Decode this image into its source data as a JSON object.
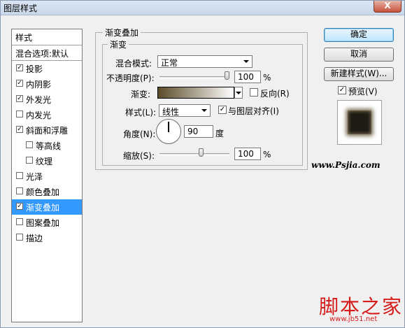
{
  "window": {
    "title": "图层样式",
    "close": "X"
  },
  "left_panel": {
    "header": "样式",
    "blend_options": "混合选项:默认",
    "items": [
      {
        "label": "投影",
        "checked": true
      },
      {
        "label": "内阴影",
        "checked": true
      },
      {
        "label": "外发光",
        "checked": true
      },
      {
        "label": "内发光",
        "checked": false
      },
      {
        "label": "斜面和浮雕",
        "checked": true
      },
      {
        "label": "等高线",
        "checked": false
      },
      {
        "label": "纹理",
        "checked": false
      },
      {
        "label": "光泽",
        "checked": false
      },
      {
        "label": "颜色叠加",
        "checked": false
      },
      {
        "label": "渐变叠加",
        "checked": true,
        "selected": true
      },
      {
        "label": "图案叠加",
        "checked": false
      },
      {
        "label": "描边",
        "checked": false
      }
    ]
  },
  "gradient_overlay": {
    "outer_title": "渐变叠加",
    "inner_title": "渐变",
    "blend_mode_label": "混合模式:",
    "blend_mode_value": "正常",
    "opacity_label": "不透明度(P):",
    "opacity_value": "100",
    "opacity_unit": "%",
    "opacity_fraction": 1.0,
    "gradient_label": "渐变:",
    "reverse_label": "反向(R)",
    "reverse_checked": false,
    "style_label": "样式(L):",
    "style_value": "线性",
    "align_label": "与图层对齐(I)",
    "align_checked": true,
    "angle_label": "角度(N):",
    "angle_value": "90",
    "angle_unit": "度",
    "scale_label": "缩放(S):",
    "scale_value": "100",
    "scale_unit": "%",
    "scale_fraction": 0.6
  },
  "buttons": {
    "ok": "确定",
    "cancel": "取消",
    "new_style": "新建样式(W)...",
    "preview_label": "预览(V)",
    "preview_checked": true
  },
  "watermarks": {
    "site1": "www.Psjia.com",
    "site2": "脚本之家",
    "site3": "www.jb51.net"
  },
  "colors": {
    "selection": "#3399ff",
    "gradient_start": "#5a4a28",
    "gradient_end": "#ffffff",
    "watermark_red": "#d61b1b"
  }
}
